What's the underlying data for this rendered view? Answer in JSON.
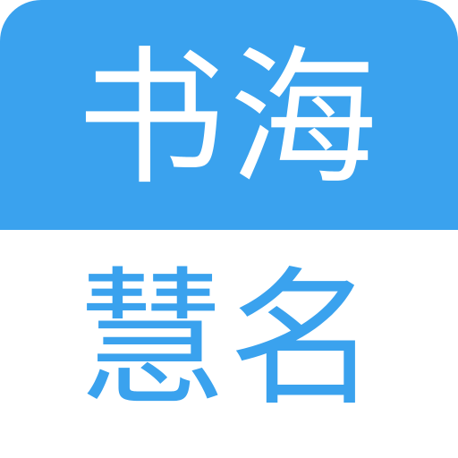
{
  "icon": {
    "top_text": "书海",
    "bottom_text": "慧名",
    "colors": {
      "accent_blue": "#3aa2ee",
      "text_on_blue": "#ffffff",
      "bottom_background": "#ffffff",
      "bottom_text": "#3aa2ee"
    }
  }
}
